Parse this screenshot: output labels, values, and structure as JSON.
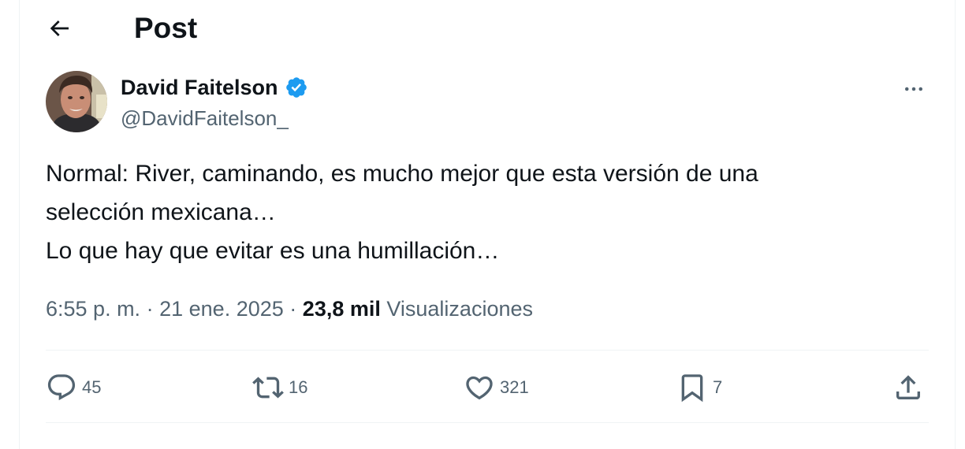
{
  "header": {
    "title": "Post",
    "back_icon": "arrow-left-icon"
  },
  "post": {
    "author": {
      "display_name": "David Faitelson",
      "handle": "@DavidFaitelson_",
      "verified": true,
      "verified_color": "#1d9bf0"
    },
    "text_lines": [
      "Normal: River, caminando, es mucho mejor que esta versión de una",
      "selección mexicana…",
      "Lo que hay que evitar es una humillación…"
    ],
    "time": "6:55 p. m.",
    "date": "21 ene. 2025",
    "separator": "·",
    "views_count": "23,8 mil",
    "views_label": "Visualizaciones"
  },
  "actions": {
    "replies": {
      "icon": "reply-icon",
      "count": "45"
    },
    "reposts": {
      "icon": "repost-icon",
      "count": "16"
    },
    "likes": {
      "icon": "heart-icon",
      "count": "321"
    },
    "bookmarks": {
      "icon": "bookmark-icon",
      "count": "7"
    },
    "share": {
      "icon": "share-icon"
    }
  },
  "colors": {
    "text_primary": "#0f1419",
    "text_secondary": "#536471",
    "divider": "#eff3f4",
    "accent": "#1d9bf0"
  }
}
